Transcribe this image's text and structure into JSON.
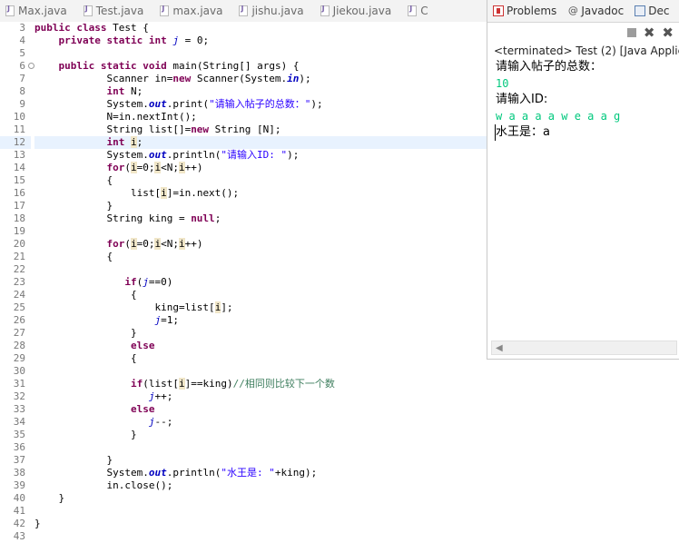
{
  "editor_tabs": [
    "Max.java",
    "Test.java",
    "max.java",
    "jishu.java",
    "Jiekou.java",
    "C"
  ],
  "console": {
    "tabs": [
      "Problems",
      "Javadoc",
      "Dec"
    ],
    "title": "<terminated> Test (2) [Java Applica",
    "output": [
      "请输入帖子的总数：",
      "10",
      "请输入ID:",
      "w a a a a w e a a g",
      "水王是：a"
    ]
  },
  "code": {
    "line_numbers": [
      "3",
      "4",
      "5",
      "6",
      "7",
      "8",
      "9",
      "10",
      "11",
      "12",
      "13",
      "14",
      "15",
      "16",
      "17",
      "18",
      "19",
      "20",
      "21",
      "22",
      "23",
      "24",
      "25",
      "26",
      "27",
      "28",
      "29",
      "30",
      "31",
      "32",
      "33",
      "34",
      "35",
      "36",
      "37",
      "38",
      "39",
      "40",
      "41",
      "42",
      "43"
    ]
  }
}
